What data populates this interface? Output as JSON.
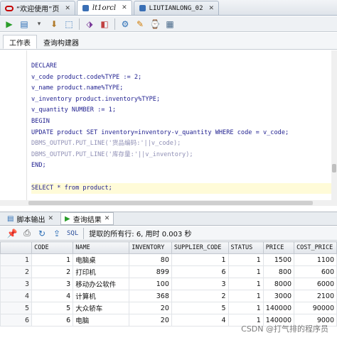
{
  "tabs": [
    {
      "label": "“欢迎使用”页",
      "active": false
    },
    {
      "label": "lt1orcl",
      "active": true
    },
    {
      "label": "LIUTIANLONG_02",
      "active": false
    }
  ],
  "subtabs": [
    "工作表",
    "查询构建器"
  ],
  "code_lines": [
    {
      "text": "DECLARE",
      "style": "normal"
    },
    {
      "text": "v_code product.code%TYPE := 2;",
      "style": "normal"
    },
    {
      "text": "v_name product.name%TYPE;",
      "style": "normal"
    },
    {
      "text": "v_inventory product.inventory%TYPE;",
      "style": "normal"
    },
    {
      "text": "v_quantity NUMBER := 1;",
      "style": "normal"
    },
    {
      "text": "BEGIN",
      "style": "normal"
    },
    {
      "text": "UPDATE product SET inventory=inventory-v_quantity WHERE code = v_code;",
      "style": "normal"
    },
    {
      "text": "DBMS_OUTPUT.PUT_LINE('货品编码:'||v_code);",
      "style": "gray"
    },
    {
      "text": "DBMS_OUTPUT.PUT_LINE('库存量:'||v_inventory);",
      "style": "gray"
    },
    {
      "text": "END;",
      "style": "normal"
    },
    {
      "text": "",
      "style": "normal"
    },
    {
      "text": "SELECT * from product;",
      "style": "highlight"
    }
  ],
  "panel_tabs": [
    {
      "label": "脚本输出",
      "active": false
    },
    {
      "label": "查询结果",
      "active": true
    }
  ],
  "results_toolbar": {
    "sql_label": "SQL",
    "status": "提取的所有行: 6, 用时 0.003 秒"
  },
  "grid": {
    "columns": [
      "CODE",
      "NAME",
      "INVENTORY",
      "SUPPLIER_CODE",
      "STATUS",
      "PRICE",
      "COST_PRICE"
    ],
    "rows": [
      [
        "1",
        "1",
        "电脑桌",
        "80",
        "1",
        "1",
        "1500",
        "1100"
      ],
      [
        "2",
        "2",
        "打印机",
        "899",
        "6",
        "1",
        "800",
        "600"
      ],
      [
        "3",
        "3",
        "移动办公软件",
        "100",
        "3",
        "1",
        "8000",
        "6000"
      ],
      [
        "4",
        "4",
        "计算机",
        "368",
        "2",
        "1",
        "3000",
        "2100"
      ],
      [
        "5",
        "5",
        "大众轿车",
        "20",
        "5",
        "1",
        "140000",
        "90000"
      ],
      [
        "6",
        "6",
        "电脑",
        "20",
        "4",
        "1",
        "140000",
        "9000"
      ]
    ]
  },
  "watermark": "CSDN @打气排的程序员",
  "colors": {
    "keyword": "#1f1f8f",
    "comment_line": "#8f8fb5",
    "accent_red": "#c40000"
  }
}
